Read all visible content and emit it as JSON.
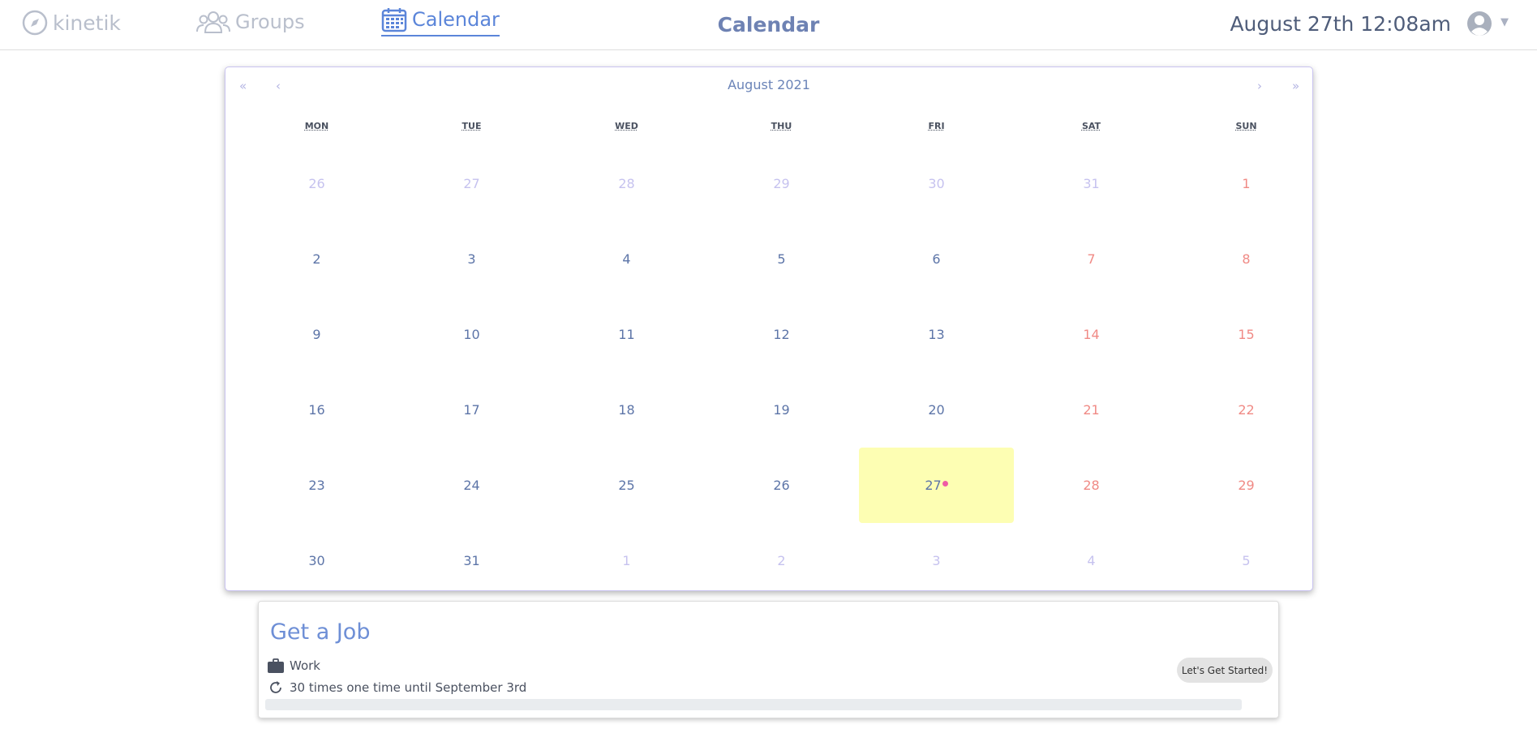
{
  "nav": {
    "logo_label": "kinetik",
    "groups_label": "Groups",
    "calendar_label": "Calendar",
    "page_title": "Calendar",
    "clock": "August 27th 12:08am"
  },
  "calendar": {
    "month_label": "August 2021",
    "prev_year": "«",
    "prev_month": "‹",
    "next_month": "›",
    "next_year": "»",
    "weekdays": [
      "MON",
      "TUE",
      "WED",
      "THU",
      "FRI",
      "SAT",
      "SUN"
    ],
    "weeks": [
      [
        {
          "d": "26",
          "t": "other"
        },
        {
          "d": "27",
          "t": "other"
        },
        {
          "d": "28",
          "t": "other"
        },
        {
          "d": "29",
          "t": "other"
        },
        {
          "d": "30",
          "t": "other"
        },
        {
          "d": "31",
          "t": "other"
        },
        {
          "d": "1",
          "t": "weekend"
        }
      ],
      [
        {
          "d": "2",
          "t": ""
        },
        {
          "d": "3",
          "t": ""
        },
        {
          "d": "4",
          "t": ""
        },
        {
          "d": "5",
          "t": ""
        },
        {
          "d": "6",
          "t": ""
        },
        {
          "d": "7",
          "t": "weekend"
        },
        {
          "d": "8",
          "t": "weekend"
        }
      ],
      [
        {
          "d": "9",
          "t": ""
        },
        {
          "d": "10",
          "t": ""
        },
        {
          "d": "11",
          "t": ""
        },
        {
          "d": "12",
          "t": ""
        },
        {
          "d": "13",
          "t": ""
        },
        {
          "d": "14",
          "t": "weekend"
        },
        {
          "d": "15",
          "t": "weekend"
        }
      ],
      [
        {
          "d": "16",
          "t": ""
        },
        {
          "d": "17",
          "t": ""
        },
        {
          "d": "18",
          "t": ""
        },
        {
          "d": "19",
          "t": ""
        },
        {
          "d": "20",
          "t": ""
        },
        {
          "d": "21",
          "t": "weekend"
        },
        {
          "d": "22",
          "t": "weekend"
        }
      ],
      [
        {
          "d": "23",
          "t": ""
        },
        {
          "d": "24",
          "t": ""
        },
        {
          "d": "25",
          "t": ""
        },
        {
          "d": "26",
          "t": ""
        },
        {
          "d": "27",
          "t": "today"
        },
        {
          "d": "28",
          "t": "weekend"
        },
        {
          "d": "29",
          "t": "weekend"
        }
      ],
      [
        {
          "d": "30",
          "t": ""
        },
        {
          "d": "31",
          "t": ""
        },
        {
          "d": "1",
          "t": "other"
        },
        {
          "d": "2",
          "t": "other"
        },
        {
          "d": "3",
          "t": "other"
        },
        {
          "d": "4",
          "t": "other"
        },
        {
          "d": "5",
          "t": "other"
        }
      ]
    ],
    "colors": {
      "accent": "#6e8fd6",
      "today": "#fdfeb3",
      "weekend": "#f08a85",
      "other_month": "#c6c2ef",
      "event_dot": "#ef5aa5"
    }
  },
  "task": {
    "title": "Get a Job",
    "category": "Work",
    "category_icon": "briefcase-icon",
    "recurrence": "30 times one time until September 3rd",
    "recurrence_icon": "repeat-icon",
    "button_label": "Let's Get Started!",
    "progress": 0
  }
}
